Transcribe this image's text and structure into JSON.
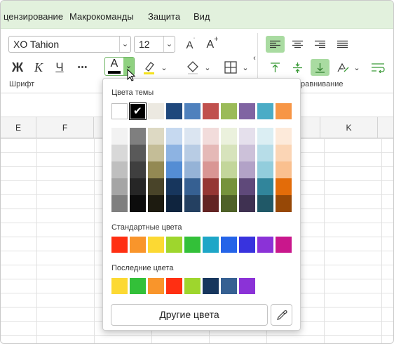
{
  "menu": {
    "items": [
      "цензирование",
      "Макрокоманды",
      "Защита",
      "Вид"
    ]
  },
  "ribbon": {
    "font_name": "XO Tahion",
    "font_size": "12",
    "grow_font": "A",
    "shrink_font": "A",
    "bold": "Ж",
    "italic": "К",
    "underline": "Ч",
    "more": "•••",
    "font_color_letter": "A",
    "group_font_label": "Шрифт",
    "group_align_label": "равнивание",
    "font_color_hex": "#000000",
    "highlight_color_hex": "#f5e31f"
  },
  "sheet": {
    "columns": [
      "E",
      "F",
      "",
      "",
      "",
      "",
      "K"
    ]
  },
  "color_picker": {
    "theme_label": "Цвета темы",
    "theme_colors": [
      "#ffffff",
      "#000000",
      "#ece9e1",
      "#1f487c",
      "#4f81bd",
      "#c0504d",
      "#9bbb59",
      "#8064a2",
      "#4bacc6",
      "#f79646"
    ],
    "selected_theme_index": 1,
    "tints": [
      [
        "#f2f2f2",
        "#7f7f7f",
        "#ddd9c3",
        "#c6d9f0",
        "#dbe5f1",
        "#f2dcdb",
        "#ebf1dd",
        "#e5e0ec",
        "#dbeef3",
        "#fdeada"
      ],
      [
        "#d8d8d8",
        "#595959",
        "#c4bd97",
        "#8db3e2",
        "#b8cce4",
        "#e5b9b7",
        "#d7e3bc",
        "#ccc1d9",
        "#b7dde8",
        "#fbd5b5"
      ],
      [
        "#bfbfbf",
        "#3f3f3f",
        "#938953",
        "#548dd4",
        "#95b3d7",
        "#d99694",
        "#c3d69b",
        "#b2a2c7",
        "#92cddc",
        "#fac08f"
      ],
      [
        "#a5a5a5",
        "#262626",
        "#494429",
        "#17365d",
        "#366092",
        "#953734",
        "#76923c",
        "#5f497a",
        "#31859b",
        "#e36c09"
      ],
      [
        "#7f7f7f",
        "#0c0c0c",
        "#1d1b10",
        "#0f243e",
        "#244061",
        "#632423",
        "#4f6128",
        "#3f3151",
        "#205867",
        "#974806"
      ]
    ],
    "standard_label": "Стандартные цвета",
    "standard_colors": [
      "#ff2f12",
      "#f9952b",
      "#fcd933",
      "#9ed62d",
      "#33c039",
      "#1ea6c7",
      "#2564e8",
      "#3833de",
      "#8b32d7",
      "#c9178c"
    ],
    "recent_label": "Последние цвета",
    "recent_colors": [
      "#fcd933",
      "#33c039",
      "#f9952b",
      "#ff2f12",
      "#9ed62d",
      "#17365d",
      "#366092",
      "#8b32d7"
    ],
    "more_colors_label": "Другие цвета"
  }
}
